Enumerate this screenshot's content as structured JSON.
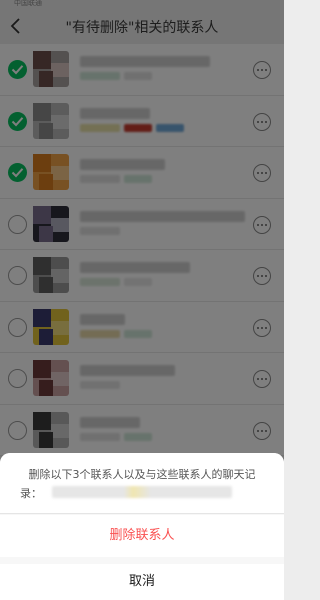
{
  "status_bar": {
    "carrier": "中国联通"
  },
  "nav": {
    "title": "\"有待删除\"相关的联系人",
    "back_icon": "chevron-left-icon"
  },
  "contacts": [
    {
      "checked": true,
      "avatar_colors": [
        "#a8a3a0",
        "#6d4f4a",
        "#d9c4c0"
      ],
      "name_width": 130,
      "sub_colors": [
        "#cfe7d8",
        "#e0e0e0"
      ]
    },
    {
      "checked": true,
      "avatar_colors": [
        "#b8b8b8",
        "#8c8c8c",
        "#d6d6d6"
      ],
      "name_width": 70,
      "sub_colors": [
        "#e8e0a8",
        "#c63b2f",
        "#6fa8d8"
      ]
    },
    {
      "checked": true,
      "avatar_colors": [
        "#f1a347",
        "#d87d1e",
        "#f7c98a"
      ],
      "name_width": 85,
      "sub_colors": [
        "#e0e0e0",
        "#cfe7d8"
      ]
    },
    {
      "checked": false,
      "avatar_colors": [
        "#2f2f3a",
        "#7a6f8e",
        "#b0b0c0"
      ],
      "name_width": 165,
      "sub_colors": [
        "#e0e0e0"
      ]
    },
    {
      "checked": false,
      "avatar_colors": [
        "#9a9a9a",
        "#5e5e5e",
        "#c8c8c8"
      ],
      "name_width": 110,
      "sub_colors": [
        "#d8e7d8",
        "#e6e6e6"
      ]
    },
    {
      "checked": false,
      "avatar_colors": [
        "#e2c43a",
        "#3a3a6e",
        "#f0dc7c"
      ],
      "name_width": 45,
      "sub_colors": [
        "#e8d9a8",
        "#cfe7d8"
      ]
    },
    {
      "checked": false,
      "avatar_colors": [
        "#c9a0a0",
        "#6d3a3a",
        "#e0c8c8"
      ],
      "name_width": 95,
      "sub_colors": [
        "#e3e3e3"
      ]
    },
    {
      "checked": false,
      "avatar_colors": [
        "#b0b0b0",
        "#3a3a3a",
        "#d0d0d0"
      ],
      "name_width": 60,
      "sub_colors": [
        "#e0e0e0",
        "#cfe7d8"
      ]
    }
  ],
  "colors": {
    "accent_green": "#07c160",
    "danger_red": "#fa5151"
  },
  "sheet": {
    "message_line1": "删除以下3个联系人以及与这些联系人的聊天记",
    "message_line2": "录：",
    "delete_label": "删除联系人",
    "cancel_label": "取消"
  }
}
